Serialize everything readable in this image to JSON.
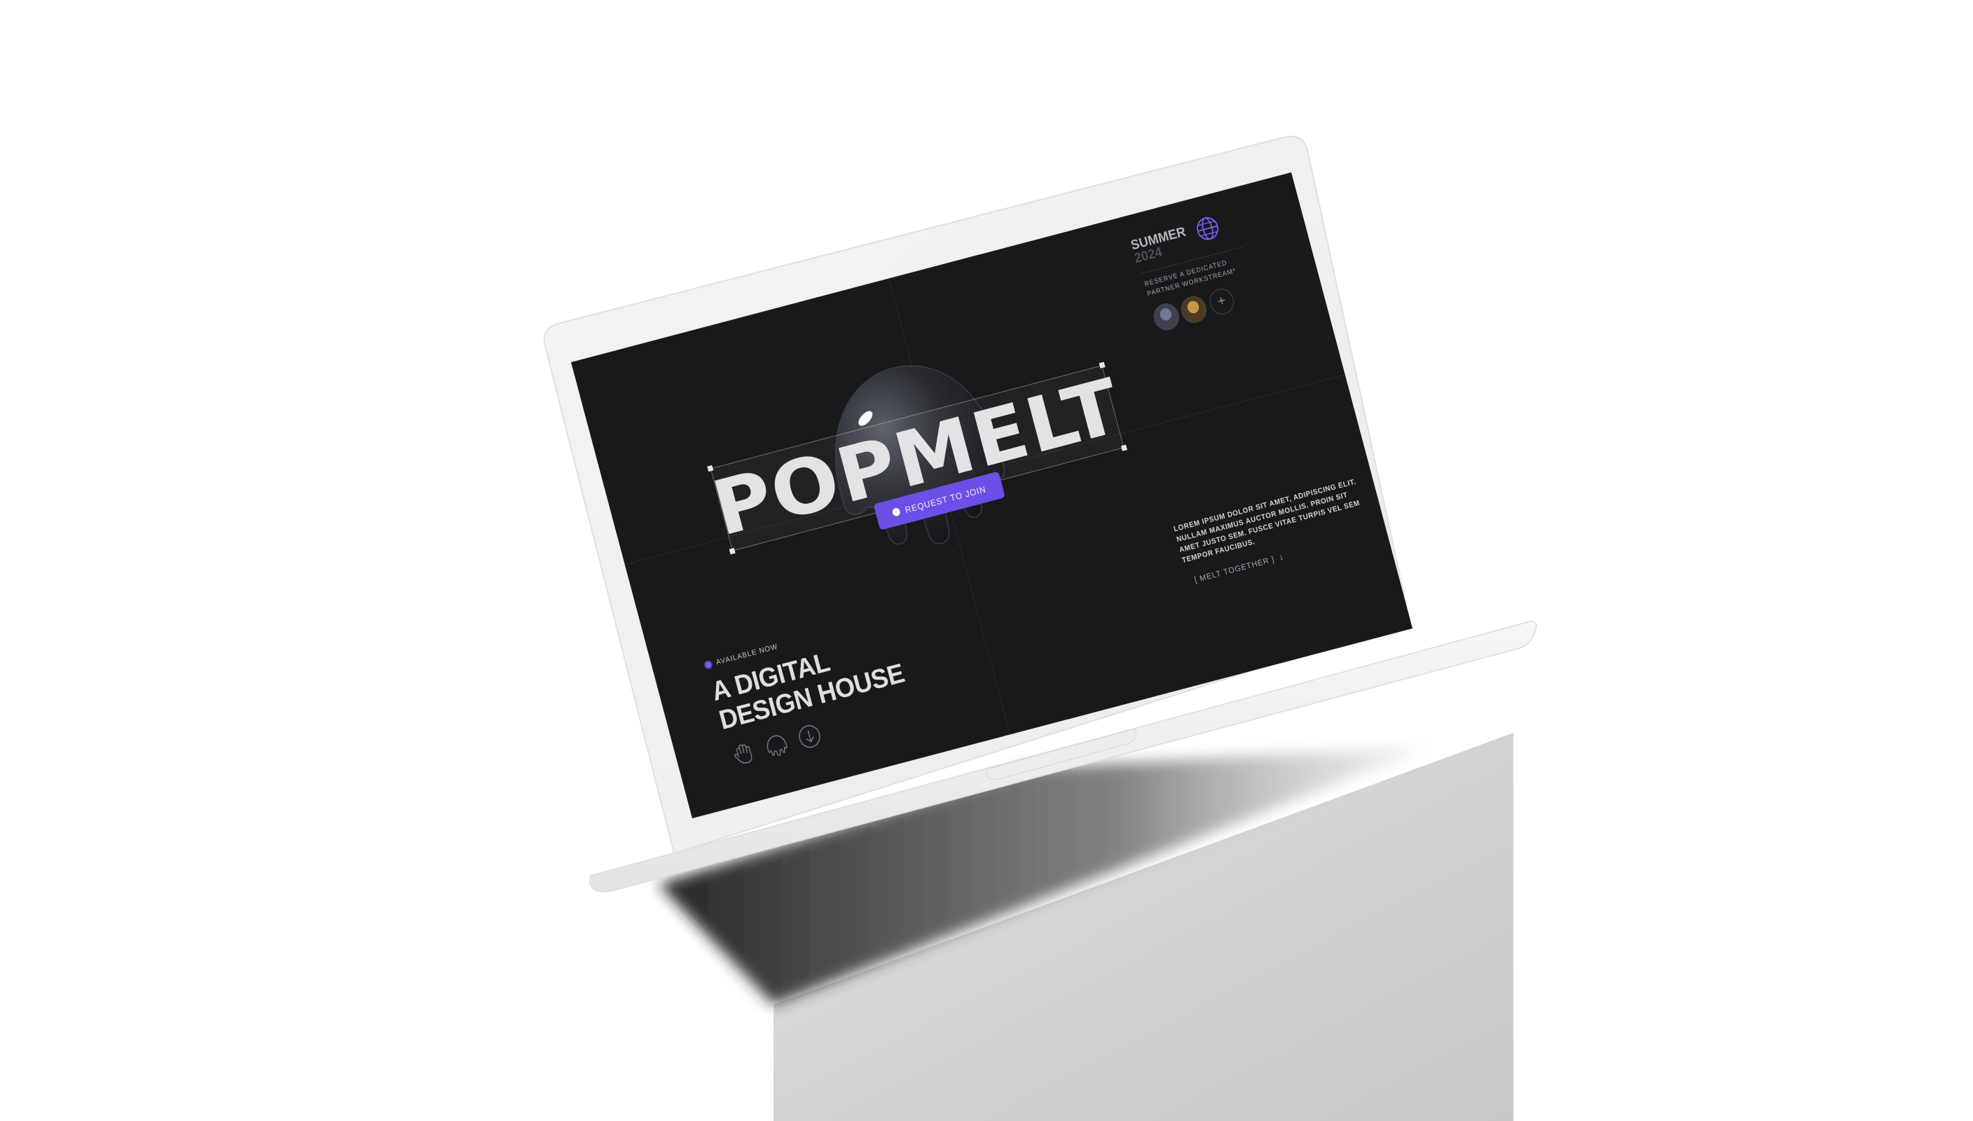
{
  "scene": {
    "device": "laptop-mockup",
    "background_color": "#ffffff",
    "screen_background": "#18191b",
    "accent_color": "#6d4ee6"
  },
  "site": {
    "logo": "POPMELT",
    "cta_label": "REQUEST TO JOIN",
    "cta_icon": "hand-icon",
    "season": {
      "label": "SUMMER",
      "year": "2024"
    },
    "globe_icon": "globe-icon",
    "reserve_text": "RESERVE A DEDICATED PARTNER WORKSTREAM*",
    "avatars": [
      "avatar-1",
      "avatar-2"
    ],
    "add_symbol": "+",
    "description": "LOREM IPSUM DOLOR SIT AMET, ADIPISCING ELIT. NULLAM MAXIMUS AUCTOR MOLLIS. PROIN SIT AMET JUSTO SEM. FUSCE VITAE TURPIS VEL SEM TEMPOR FAUCIBUS.",
    "melt_link": "[ MELT TOGETHER ]",
    "melt_arrow": "↓",
    "status": "AVAILABLE NOW",
    "headline_line1": "A DIGITAL",
    "headline_line2": "DESIGN HOUSE",
    "bottom_icons": [
      "hand-outline-icon",
      "jelly-outline-icon",
      "arrow-down-circle-icon"
    ]
  }
}
